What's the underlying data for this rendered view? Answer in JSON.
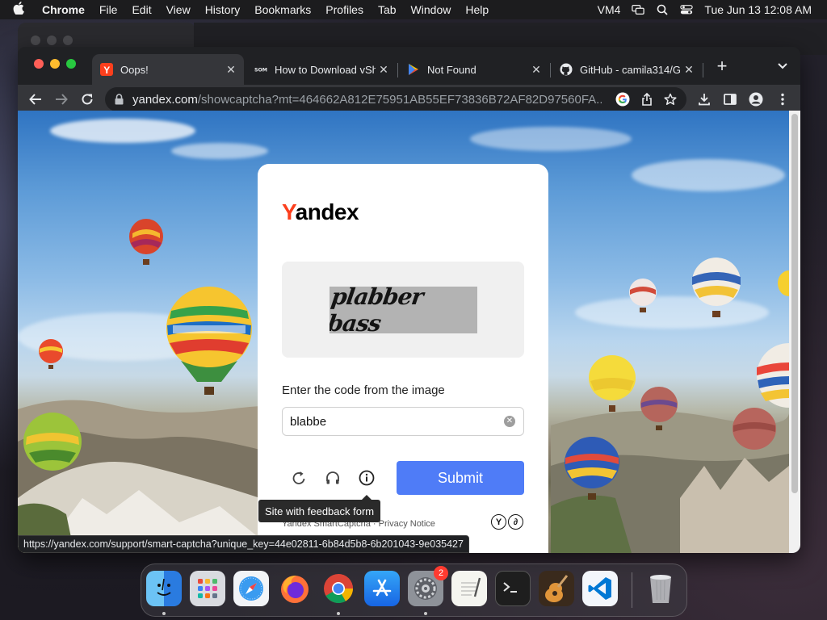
{
  "menubar": {
    "app_name": "Chrome",
    "items": [
      "File",
      "Edit",
      "View",
      "History",
      "Bookmarks",
      "Profiles",
      "Tab",
      "Window",
      "Help"
    ],
    "vm_label": "VM4",
    "clock": "Tue Jun 13  12:08 AM"
  },
  "browser": {
    "tabs": [
      {
        "title": "Oops!",
        "favicon": "yandex-icon",
        "active": true
      },
      {
        "title": "How to Download vSh",
        "favicon": "som-icon",
        "active": false
      },
      {
        "title": "Not Found",
        "favicon": "play-icon",
        "active": false
      },
      {
        "title": "GitHub - camila314/G",
        "favicon": "github-icon",
        "active": false
      }
    ],
    "url_host": "yandex.com",
    "url_path": "/showcaptcha?mt=464662A812E75951AB55EF73836B72AF82D97560FA...",
    "status_url": "https://yandex.com/support/smart-captcha?unique_key=44e02811-6b84d5b8-6b201043-9e035427"
  },
  "captcha": {
    "logo_first": "Y",
    "logo_rest": "andex",
    "image_text": "plabber bass",
    "prompt": "Enter the code from the image",
    "input_value": "blabbe",
    "submit_label": "Submit",
    "tooltip": "Site with feedback form",
    "footer": "Yandex SmartCaptcha · Privacy Notice",
    "brand_marks": [
      "Y",
      "∂"
    ]
  },
  "dock": {
    "apps": [
      "Finder",
      "Launchpad",
      "Safari",
      "Firefox",
      "Chrome",
      "App Store",
      "System Settings",
      "TextEdit",
      "Terminal",
      "GarageBand",
      "VS Code",
      "Trash"
    ],
    "settings_badge": "2"
  },
  "colors": {
    "yandex_red": "#fc3f1d",
    "submit_blue": "#4f7cf7"
  }
}
